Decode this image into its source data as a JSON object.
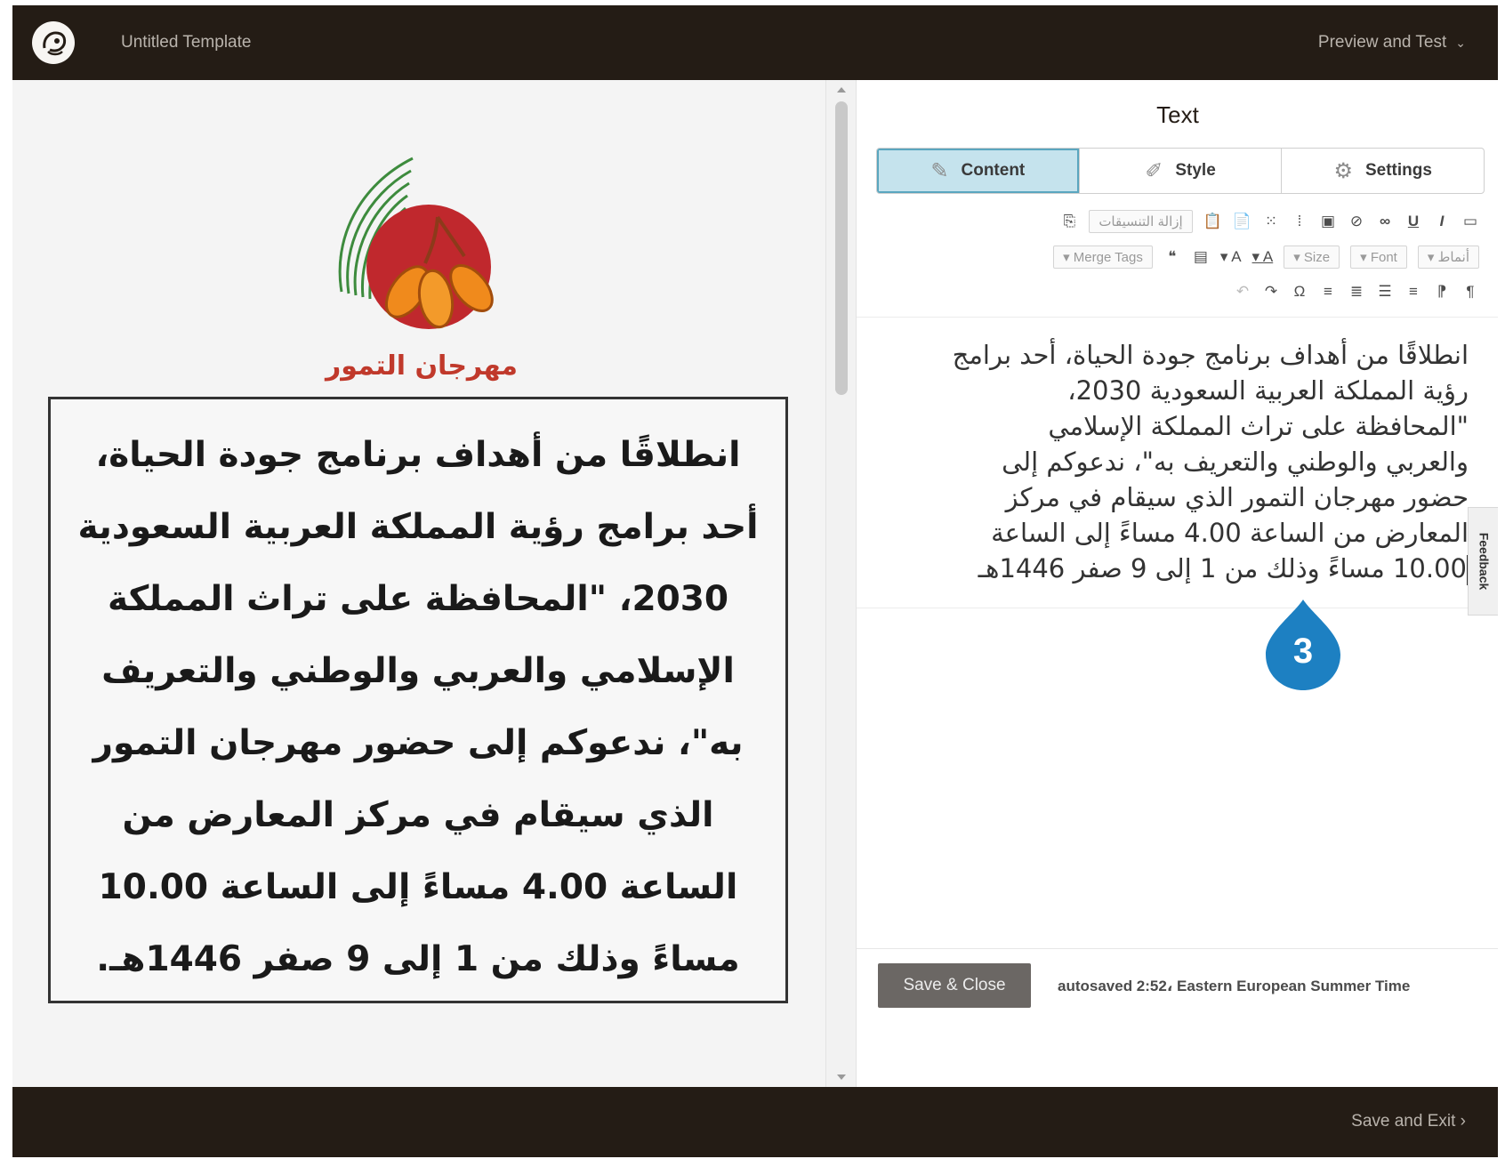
{
  "app": {
    "logo_icon": "freddie-logo-icon",
    "template_title": "Untitled Template",
    "preview_label": "Preview and Test"
  },
  "canvas": {
    "festival_name": "مهرجان التمور",
    "body_text": "انطلاقًا من أهداف برنامج جودة الحياة، أحد برامج رؤية المملكة العربية السعودية 2030، \"المحافظة على تراث المملكة الإسلامي والعربي والوطني والتعريف به\"، ندعوكم إلى حضور مهرجان التمور الذي سيقام في مركز المعارض من الساعة 4.00 مساءً إلى الساعة 10.00 مساءً وذلك من 1 إلى 9 صفر 1446هـ."
  },
  "panel": {
    "title": "Text",
    "tabs": [
      {
        "label": "Content",
        "icon": "pencil-icon",
        "active": true
      },
      {
        "label": "Style",
        "icon": "brush-icon",
        "active": false
      },
      {
        "label": "Settings",
        "icon": "gear-icon",
        "active": false
      }
    ],
    "toolbar": {
      "remove_format_label": "إزالة التنسيقات",
      "merge_tags_label": "Merge Tags",
      "size_label": "Size",
      "font_label": "Font",
      "styles_label": "أنماط"
    },
    "editor_lines": [
      "انطلاقًا من أهداف برنامج جودة الحياة، أحد برامج",
      "رؤية المملكة العربية السعودية 2030،",
      "\"المحافظة على تراث المملكة الإسلامي",
      "والعربي والوطني والتعريف به\"، ندعوكم إلى",
      "حضور مهرجان التمور الذي سيقام في مركز",
      "المعارض من الساعة 4.00 مساءً إلى الساعة",
      "10.00 مساءً وذلك من 1 إلى 9 صفر 1446هـ"
    ],
    "feedback_label": "Feedback",
    "step_number": "3",
    "save_close_label": "Save & Close",
    "autosaved_text": "autosaved 2:52، Eastern European Summer Time"
  },
  "footer": {
    "save_exit_label": "Save and Exit",
    "save_exit_chevron": "›"
  },
  "colors": {
    "topbar": "#241c15",
    "active_tab": "#c5e3ed",
    "festival_red": "#c0392b",
    "step_marker": "#1d80c2",
    "save_button": "#6b6764"
  }
}
